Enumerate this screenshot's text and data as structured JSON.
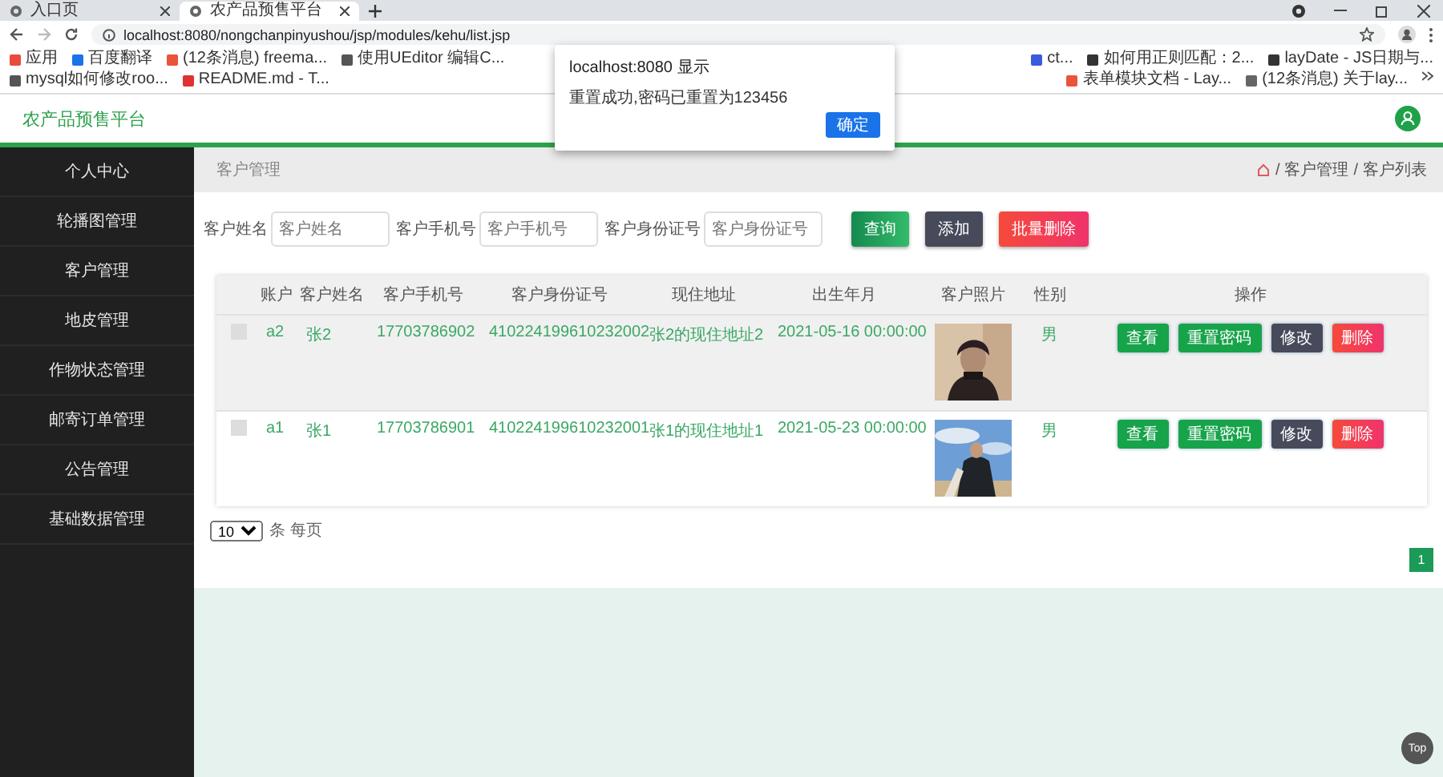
{
  "browser": {
    "tabs": [
      {
        "label": "入口页",
        "selected": false
      },
      {
        "label": "农产品预售平台",
        "selected": true
      }
    ],
    "address": "localhost:8080/nongchanpinyushou/jsp/modules/kehu/list.jsp",
    "bookmarks_left": [
      "应用",
      "百度翻译",
      "(12条消息) freema...",
      "使用UEditor 编辑C...",
      "mysql如何修改roo...",
      "README.md - T..."
    ],
    "bookmarks_right": [
      "ct...",
      "如何用正则匹配：2...",
      "layDate - JS日期与...",
      "表单模块文档 - Lay...",
      "(12条消息) 关于lay..."
    ]
  },
  "header": {
    "title": "农产品预售平台"
  },
  "sidebar": {
    "items": [
      "个人中心",
      "轮播图管理",
      "客户管理",
      "地皮管理",
      "作物状态管理",
      "邮寄订单管理",
      "公告管理",
      "基础数据管理"
    ]
  },
  "breadcrumb": {
    "page_title": "客户管理",
    "separator": "/",
    "trail": [
      "客户管理",
      "客户列表"
    ]
  },
  "search": {
    "fields": [
      {
        "label": "客户姓名",
        "placeholder": "客户姓名"
      },
      {
        "label": "客户手机号",
        "placeholder": "客户手机号"
      },
      {
        "label": "客户身份证号",
        "placeholder": "客户身份证号"
      }
    ],
    "buttons": [
      {
        "label": "查询",
        "kind": "search"
      },
      {
        "label": "添加",
        "kind": "add"
      },
      {
        "label": "批量删除",
        "kind": "delete"
      }
    ]
  },
  "table": {
    "columns": [
      "账户",
      "客户姓名",
      "客户手机号",
      "客户身份证号",
      "现住地址",
      "出生年月",
      "客户照片",
      "性别",
      "操作"
    ],
    "rows": [
      {
        "selected": true,
        "checked": false,
        "cells": [
          "a2",
          "张2",
          "17703786902",
          "410224199610232002",
          "张2的现住地址2",
          "2021-05-16 00:00:00"
        ],
        "photo": {
          "kind": "picture"
        },
        "gender": "男",
        "actions": [
          {
            "label": "查看",
            "kind": "view"
          },
          {
            "label": "重置密码",
            "kind": "reset"
          },
          {
            "label": "修改",
            "kind": "edit"
          },
          {
            "label": "删除",
            "kind": "delete"
          }
        ]
      },
      {
        "selected": false,
        "checked": false,
        "cells": [
          "a1",
          "张1",
          "17703786901",
          "410224199610232001",
          "张1的现住地址1",
          "2021-05-23 00:00:00"
        ],
        "photo": {
          "kind": "picture"
        },
        "gender": "男",
        "actions": [
          {
            "label": "查看",
            "kind": "view"
          },
          {
            "label": "重置密码",
            "kind": "reset"
          },
          {
            "label": "修改",
            "kind": "edit"
          },
          {
            "label": "删除",
            "kind": "delete"
          }
        ]
      }
    ]
  },
  "pagination": {
    "page_size": "10",
    "unit": "条 每页",
    "pages": [
      {
        "label": "1",
        "selected": true
      }
    ]
  },
  "dialog": {
    "title": "localhost:8080 显示",
    "message": "重置成功,密码已重置为123456",
    "button": "确定"
  },
  "top_button": "Top"
}
